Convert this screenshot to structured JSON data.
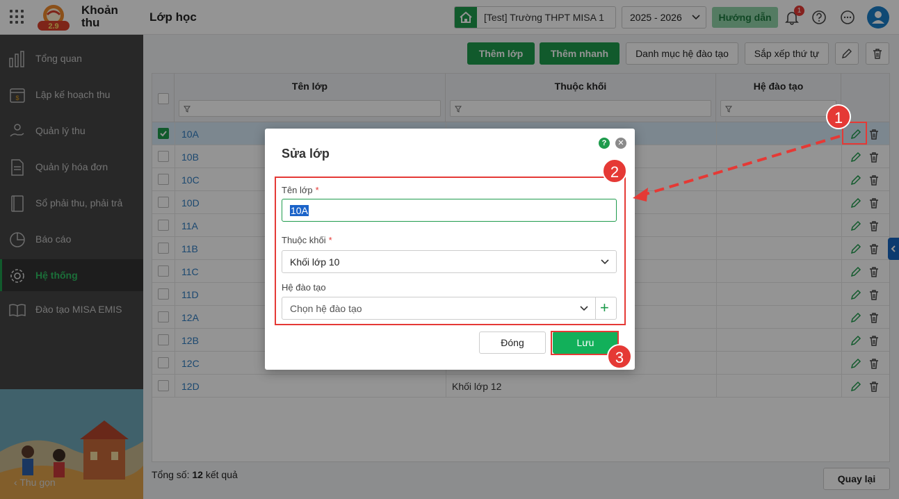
{
  "app": {
    "name_line1": "Khoản",
    "name_line2": "thu",
    "logo_text": "2.9"
  },
  "header": {
    "page_title": "Lớp học",
    "school": "[Test] Trường THPT MISA 1",
    "year": "2025 - 2026",
    "guide": "Hướng dẫn",
    "notification_count": "1"
  },
  "sidebar": {
    "items": [
      {
        "label": "Tổng quan",
        "icon": "chart-bars-icon"
      },
      {
        "label": "Lập kế hoạch thu",
        "icon": "calendar-money-icon"
      },
      {
        "label": "Quản lý thu",
        "icon": "hand-coin-icon"
      },
      {
        "label": "Quản lý hóa đơn",
        "icon": "document-icon"
      },
      {
        "label": "Sổ phải thu, phải trả",
        "icon": "book-icon"
      },
      {
        "label": "Báo cáo",
        "icon": "pie-chart-icon"
      },
      {
        "label": "Hệ thống",
        "icon": "gear-icon"
      },
      {
        "label": "Đào tạo MISA EMIS",
        "icon": "open-book-icon"
      }
    ],
    "active_index": 6,
    "collapse": "Thu gọn"
  },
  "toolbar": {
    "add_class": "Thêm lớp",
    "quick_add": "Thêm nhanh",
    "training_list": "Danh mục hệ đào tạo",
    "sort_order": "Sắp xếp thứ tự"
  },
  "table": {
    "columns": [
      "Tên lớp",
      "Thuộc khối",
      "Hệ đào tạo"
    ],
    "rows": [
      {
        "name": "10A",
        "block": "",
        "selected": true
      },
      {
        "name": "10B",
        "block": ""
      },
      {
        "name": "10C",
        "block": ""
      },
      {
        "name": "10D",
        "block": ""
      },
      {
        "name": "11A",
        "block": ""
      },
      {
        "name": "11B",
        "block": ""
      },
      {
        "name": "11C",
        "block": ""
      },
      {
        "name": "11D",
        "block": ""
      },
      {
        "name": "12A",
        "block": ""
      },
      {
        "name": "12B",
        "block": ""
      },
      {
        "name": "12C",
        "block": ""
      },
      {
        "name": "12D",
        "block": "Khối lớp 12"
      }
    ]
  },
  "footer": {
    "total_prefix": "Tổng số:",
    "total_count": "12",
    "total_suffix": "kết quả",
    "back": "Quay lại"
  },
  "dialog": {
    "title": "Sửa lớp",
    "class_name_label": "Tên lớp",
    "class_name_value": "10A",
    "block_label": "Thuộc khối",
    "block_value": "Khối lớp 10",
    "training_label": "Hệ đào tạo",
    "training_placeholder": "Chọn hệ đào tạo",
    "required_mark": "*",
    "cancel": "Đóng",
    "save": "Lưu"
  },
  "annotations": {
    "step1": "1",
    "step2": "2",
    "step3": "3"
  },
  "colors": {
    "brand_green": "#1e9b4c",
    "annotation_red": "#e53935",
    "link_blue": "#2f7cc1"
  }
}
